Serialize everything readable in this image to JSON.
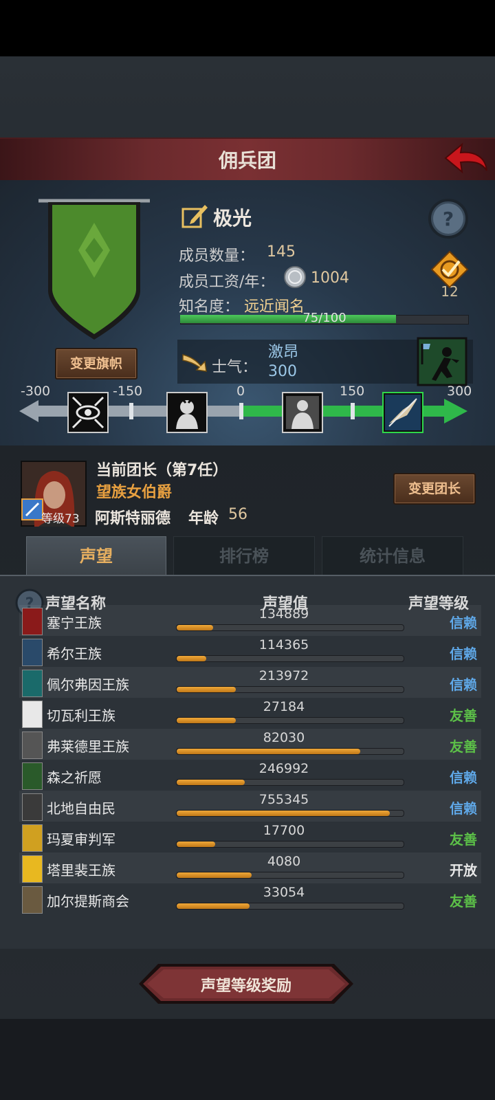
{
  "header": {
    "title": "佣兵团"
  },
  "guild": {
    "name": "极光",
    "member_count_label": "成员数量：",
    "member_count": "145",
    "wage_label": "成员工资/年：",
    "wage": "1004",
    "fame_label": "知名度：",
    "fame_value": "远近闻名",
    "fame_progress_text": "75/100",
    "fame_progress": 0.75,
    "badge_count": "12",
    "change_flag_label": "变更旗帜"
  },
  "morale": {
    "label": "士气：",
    "state": "激昂",
    "value": "300",
    "scale_ticks": [
      "-300",
      "-150",
      "0",
      "150",
      "300"
    ]
  },
  "captain": {
    "prefix": "当前团长（第7任）",
    "title": "望族女伯爵",
    "name": "阿斯特丽德",
    "age_label": "年龄",
    "age": "56",
    "level_label": "等级73",
    "change_label": "变更团长"
  },
  "tabs": [
    "声望",
    "排行榜",
    "统计信息"
  ],
  "reputation": {
    "col_name": "声望名称",
    "col_value": "声望值",
    "col_level": "声望等级",
    "rows": [
      {
        "name": "塞宁王族",
        "value": "134889",
        "level": "信赖",
        "fill": 0.16,
        "level_color": "#5fa8e8",
        "icon_color": "#8a1a1a"
      },
      {
        "name": "希尔王族",
        "value": "114365",
        "level": "信赖",
        "fill": 0.13,
        "level_color": "#5fa8e8",
        "icon_color": "#2a4a6a"
      },
      {
        "name": "佩尔弗因王族",
        "value": "213972",
        "level": "信赖",
        "fill": 0.26,
        "level_color": "#5fa8e8",
        "icon_color": "#1a6a6a"
      },
      {
        "name": "切瓦利王族",
        "value": "27184",
        "level": "友善",
        "fill": 0.26,
        "level_color": "#5cc048",
        "icon_color": "#e8e8e8"
      },
      {
        "name": "弗莱德里王族",
        "value": "82030",
        "level": "友善",
        "fill": 0.81,
        "level_color": "#5cc048",
        "icon_color": "#555555"
      },
      {
        "name": "森之祈愿",
        "value": "246992",
        "level": "信赖",
        "fill": 0.3,
        "level_color": "#5fa8e8",
        "icon_color": "#2a5a2a"
      },
      {
        "name": "北地自由民",
        "value": "755345",
        "level": "信赖",
        "fill": 0.94,
        "level_color": "#5fa8e8",
        "icon_color": "#3a3a3a"
      },
      {
        "name": "玛夏审判军",
        "value": "17700",
        "level": "友善",
        "fill": 0.17,
        "level_color": "#5cc048",
        "icon_color": "#d0a020"
      },
      {
        "name": "塔里裴王族",
        "value": "4080",
        "level": "开放",
        "fill": 0.33,
        "level_color": "#e8e8e8",
        "icon_color": "#e8b820"
      },
      {
        "name": "加尔提斯商会",
        "value": "33054",
        "level": "友善",
        "fill": 0.32,
        "level_color": "#5cc048",
        "icon_color": "#6a5a40"
      }
    ]
  },
  "reward_button": "声望等级奖励",
  "colors": {
    "accent": "#e8a040",
    "title_bar": "#6b2a2d",
    "morale_bar": "#2fb84a"
  }
}
